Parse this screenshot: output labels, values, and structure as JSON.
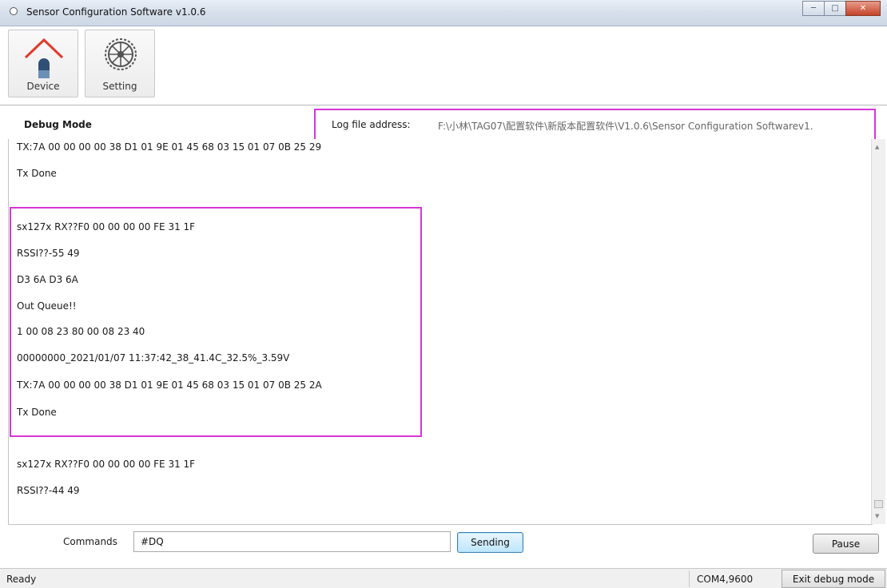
{
  "window": {
    "title": "Sensor Configuration Software v1.0.6"
  },
  "toolbar": {
    "device_label": "Device",
    "setting_label": "Setting"
  },
  "debug": {
    "mode_title": "Debug Mode",
    "log_label": "Log file address:",
    "log_path": "F:\\小林\\TAG07\\配置软件\\新版本配置软件\\V1.0.6\\Sensor Configuration Softwarev1."
  },
  "log": {
    "lines": [
      "TX:7A 00 00 00 00 38 D1 01 9E 01 45 68 03 15 01 07 0B 25 29",
      "Tx Done",
      "sx127x RX??F0 00 00 00 00 FE 31 1F",
      "RSSI??-55 49",
      "D3 6A D3 6A",
      "Out Queue!!",
      "1 00 08 23 80 00 08 23 40",
      "00000000_2021/01/07 11:37:42_38_41.4C_32.5%_3.59V",
      "TX:7A 00 00 00 00 38 D1 01 9E 01 45 68 03 15 01 07 0B 25 2A",
      "Tx Done",
      "sx127x RX??F0 00 00 00 00 FE 31 1F",
      "RSSI??-44 49"
    ]
  },
  "commands": {
    "label": "Commands",
    "value": "#DQ",
    "send_label": "Sending",
    "pause_label": "Pause"
  },
  "status": {
    "ready": "Ready",
    "port": "COM4,9600",
    "exit_label": "Exit debug mode"
  },
  "colors": {
    "highlight": "#d536d5",
    "send_button": "#bee6fd"
  }
}
